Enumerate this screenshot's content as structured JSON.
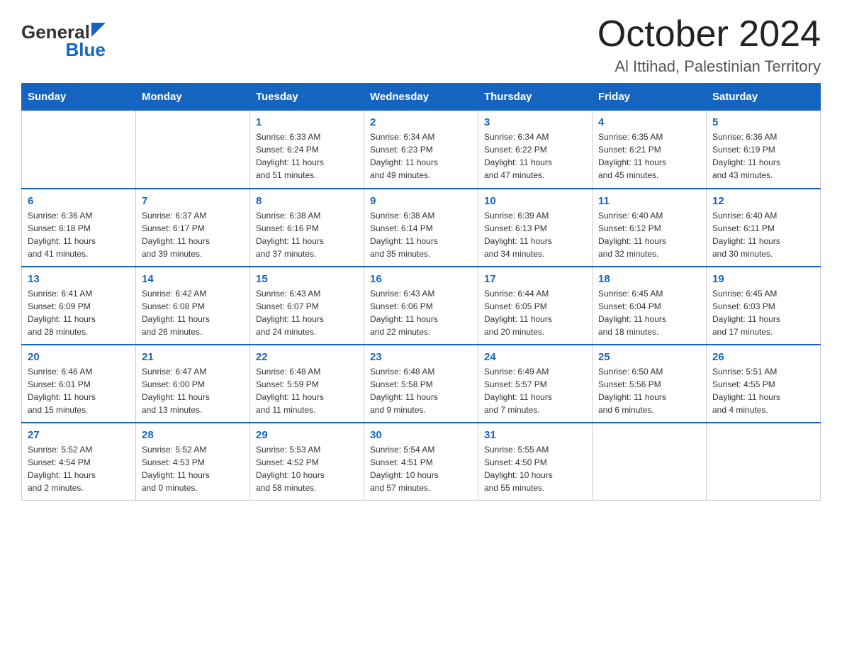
{
  "header": {
    "title": "October 2024",
    "subtitle": "Al Ittihad, Palestinian Territory",
    "logo_general": "General",
    "logo_blue": "Blue"
  },
  "days_of_week": [
    "Sunday",
    "Monday",
    "Tuesday",
    "Wednesday",
    "Thursday",
    "Friday",
    "Saturday"
  ],
  "weeks": [
    [
      {
        "day": "",
        "info": ""
      },
      {
        "day": "",
        "info": ""
      },
      {
        "day": "1",
        "info": "Sunrise: 6:33 AM\nSunset: 6:24 PM\nDaylight: 11 hours\nand 51 minutes."
      },
      {
        "day": "2",
        "info": "Sunrise: 6:34 AM\nSunset: 6:23 PM\nDaylight: 11 hours\nand 49 minutes."
      },
      {
        "day": "3",
        "info": "Sunrise: 6:34 AM\nSunset: 6:22 PM\nDaylight: 11 hours\nand 47 minutes."
      },
      {
        "day": "4",
        "info": "Sunrise: 6:35 AM\nSunset: 6:21 PM\nDaylight: 11 hours\nand 45 minutes."
      },
      {
        "day": "5",
        "info": "Sunrise: 6:36 AM\nSunset: 6:19 PM\nDaylight: 11 hours\nand 43 minutes."
      }
    ],
    [
      {
        "day": "6",
        "info": "Sunrise: 6:36 AM\nSunset: 6:18 PM\nDaylight: 11 hours\nand 41 minutes."
      },
      {
        "day": "7",
        "info": "Sunrise: 6:37 AM\nSunset: 6:17 PM\nDaylight: 11 hours\nand 39 minutes."
      },
      {
        "day": "8",
        "info": "Sunrise: 6:38 AM\nSunset: 6:16 PM\nDaylight: 11 hours\nand 37 minutes."
      },
      {
        "day": "9",
        "info": "Sunrise: 6:38 AM\nSunset: 6:14 PM\nDaylight: 11 hours\nand 35 minutes."
      },
      {
        "day": "10",
        "info": "Sunrise: 6:39 AM\nSunset: 6:13 PM\nDaylight: 11 hours\nand 34 minutes."
      },
      {
        "day": "11",
        "info": "Sunrise: 6:40 AM\nSunset: 6:12 PM\nDaylight: 11 hours\nand 32 minutes."
      },
      {
        "day": "12",
        "info": "Sunrise: 6:40 AM\nSunset: 6:11 PM\nDaylight: 11 hours\nand 30 minutes."
      }
    ],
    [
      {
        "day": "13",
        "info": "Sunrise: 6:41 AM\nSunset: 6:09 PM\nDaylight: 11 hours\nand 28 minutes."
      },
      {
        "day": "14",
        "info": "Sunrise: 6:42 AM\nSunset: 6:08 PM\nDaylight: 11 hours\nand 26 minutes."
      },
      {
        "day": "15",
        "info": "Sunrise: 6:43 AM\nSunset: 6:07 PM\nDaylight: 11 hours\nand 24 minutes."
      },
      {
        "day": "16",
        "info": "Sunrise: 6:43 AM\nSunset: 6:06 PM\nDaylight: 11 hours\nand 22 minutes."
      },
      {
        "day": "17",
        "info": "Sunrise: 6:44 AM\nSunset: 6:05 PM\nDaylight: 11 hours\nand 20 minutes."
      },
      {
        "day": "18",
        "info": "Sunrise: 6:45 AM\nSunset: 6:04 PM\nDaylight: 11 hours\nand 18 minutes."
      },
      {
        "day": "19",
        "info": "Sunrise: 6:45 AM\nSunset: 6:03 PM\nDaylight: 11 hours\nand 17 minutes."
      }
    ],
    [
      {
        "day": "20",
        "info": "Sunrise: 6:46 AM\nSunset: 6:01 PM\nDaylight: 11 hours\nand 15 minutes."
      },
      {
        "day": "21",
        "info": "Sunrise: 6:47 AM\nSunset: 6:00 PM\nDaylight: 11 hours\nand 13 minutes."
      },
      {
        "day": "22",
        "info": "Sunrise: 6:48 AM\nSunset: 5:59 PM\nDaylight: 11 hours\nand 11 minutes."
      },
      {
        "day": "23",
        "info": "Sunrise: 6:48 AM\nSunset: 5:58 PM\nDaylight: 11 hours\nand 9 minutes."
      },
      {
        "day": "24",
        "info": "Sunrise: 6:49 AM\nSunset: 5:57 PM\nDaylight: 11 hours\nand 7 minutes."
      },
      {
        "day": "25",
        "info": "Sunrise: 6:50 AM\nSunset: 5:56 PM\nDaylight: 11 hours\nand 6 minutes."
      },
      {
        "day": "26",
        "info": "Sunrise: 5:51 AM\nSunset: 4:55 PM\nDaylight: 11 hours\nand 4 minutes."
      }
    ],
    [
      {
        "day": "27",
        "info": "Sunrise: 5:52 AM\nSunset: 4:54 PM\nDaylight: 11 hours\nand 2 minutes."
      },
      {
        "day": "28",
        "info": "Sunrise: 5:52 AM\nSunset: 4:53 PM\nDaylight: 11 hours\nand 0 minutes."
      },
      {
        "day": "29",
        "info": "Sunrise: 5:53 AM\nSunset: 4:52 PM\nDaylight: 10 hours\nand 58 minutes."
      },
      {
        "day": "30",
        "info": "Sunrise: 5:54 AM\nSunset: 4:51 PM\nDaylight: 10 hours\nand 57 minutes."
      },
      {
        "day": "31",
        "info": "Sunrise: 5:55 AM\nSunset: 4:50 PM\nDaylight: 10 hours\nand 55 minutes."
      },
      {
        "day": "",
        "info": ""
      },
      {
        "day": "",
        "info": ""
      }
    ]
  ]
}
